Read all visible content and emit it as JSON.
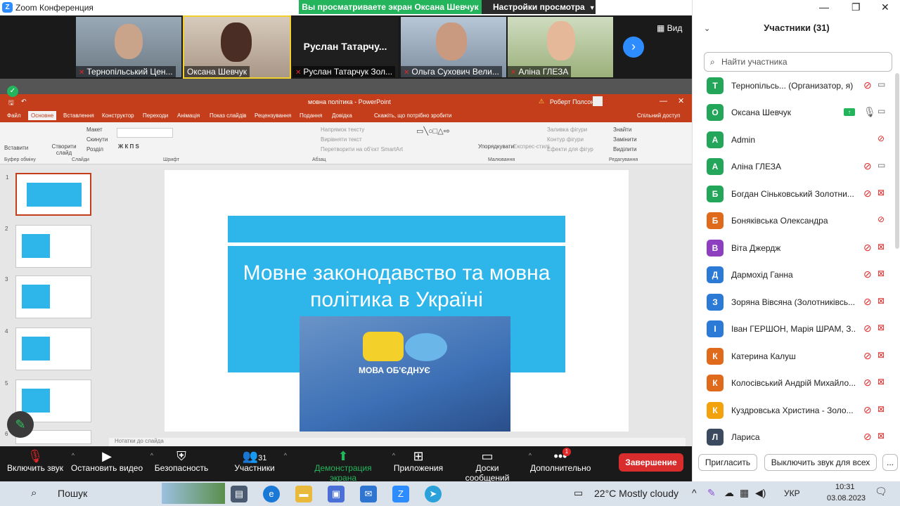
{
  "window": {
    "title": "Zoom Конференция"
  },
  "share_banner": {
    "text": "Вы просматриваете экран Оксана Шевчук",
    "view_settings": "Настройки просмотра"
  },
  "video_strip": {
    "tiles": [
      {
        "name": "Тернопільський Цен..."
      },
      {
        "name": "Оксана Шевчук"
      },
      {
        "name": "Руслан Татарчук Зол...",
        "big_name": "Руслан  Татарчу..."
      },
      {
        "name": "Ольга Сухович Вели..."
      },
      {
        "name": "Аліна ГЛЕЗА"
      }
    ],
    "view_label": "Вид"
  },
  "ppt": {
    "title": "мовна політика  -  PowerPoint",
    "user": "Роберт Полсон",
    "tabs": [
      "Файл",
      "Основне",
      "Вставлення",
      "Конструктор",
      "Переходи",
      "Анімація",
      "Показ слайдів",
      "Рецензування",
      "Подання",
      "Довідка"
    ],
    "tellme": "Скажіть, що потрібно зробити",
    "share": "Спільний доступ",
    "ribbon": {
      "paste": "Вставити",
      "clipboard": "Буфер обміну",
      "new_slide": "Створити слайд",
      "layout": "Макет",
      "reset": "Скинути",
      "section": "Розділ",
      "slides": "Слайди",
      "font": "Шрифт",
      "text_direction": "Напрямок тексту",
      "align_text": "Вирівняти текст",
      "smartart": "Перетворити на об'єкт SmartArt",
      "paragraph": "Абзац",
      "arrange": "Упорядкувати",
      "quick_styles": "Експрес-стилі",
      "shape_fill": "Заливка фігури",
      "shape_outline": "Контур фігури",
      "shape_effects": "Ефекти для фігур",
      "drawing": "Малювання",
      "find": "Знайти",
      "replace": "Замінити",
      "select": "Виділити",
      "editing": "Редагування"
    },
    "thumbs": [
      "1",
      "2",
      "3",
      "4",
      "5",
      "6"
    ],
    "slide_title": "Мовне законодавство та мовна політика в Україні",
    "slide_image_text": "МОВА ОБ'ЄДНУЄ",
    "notes": "Нотатки до слайда"
  },
  "toolbar": {
    "unmute": "Включить звук",
    "stop_video": "Остановить видео",
    "security": "Безопасность",
    "participants": "Участники",
    "participants_count": "31",
    "share_screen": "Демонстрация экрана",
    "apps": "Приложения",
    "whiteboards": "Доски сообщений",
    "more": "Дополнительно",
    "more_badge": "1",
    "end": "Завершение"
  },
  "panel": {
    "title": "Участники (31)",
    "search_placeholder": "Найти участника",
    "participants": [
      {
        "initial": "Т",
        "name": "Тернопільсь...  (Организатор, я)",
        "color": "#23a55a"
      },
      {
        "initial": "О",
        "name": "Оксана Шевчук",
        "color": "#23a55a"
      },
      {
        "initial": "A",
        "name": "Admin",
        "color": "#23a55a"
      },
      {
        "initial": "А",
        "name": "Аліна ГЛЕЗА",
        "color": "#23a55a"
      },
      {
        "initial": "Б",
        "name": "Богдан Сіньковський Золотни...",
        "color": "#23a55a"
      },
      {
        "initial": "Б",
        "name": "Боняківська Олександра",
        "color": "#e06a1b"
      },
      {
        "initial": "В",
        "name": "Віта Джердж",
        "color": "#8e3fbf"
      },
      {
        "initial": "Д",
        "name": "Дармохід Ганна",
        "color": "#2b7bd6"
      },
      {
        "initial": "З",
        "name": "Зоряна Вівсяна (Золотниківсь...",
        "color": "#2b7bd6"
      },
      {
        "initial": "І",
        "name": "Іван ГЕРШОН, Марія ШРАМ, З...",
        "color": "#2b7bd6"
      },
      {
        "initial": "К",
        "name": "Катерина Калуш",
        "color": "#e06a1b"
      },
      {
        "initial": "К",
        "name": "Колосівський Андрій Михайло...",
        "color": "#e06a1b"
      },
      {
        "initial": "К",
        "name": "Куздровська Христина - Золо...",
        "color": "#f2a20c"
      },
      {
        "initial": "Л",
        "name": "Лариса",
        "color": "#3b4a5e"
      }
    ],
    "invite": "Пригласить",
    "mute_all": "Выключить звук для всех",
    "more": "..."
  },
  "taskbar": {
    "search": "Пошук",
    "weather": "22°C  Mostly cloudy",
    "lang": "УКР",
    "time": "10:31",
    "date": "03.08.2023"
  }
}
